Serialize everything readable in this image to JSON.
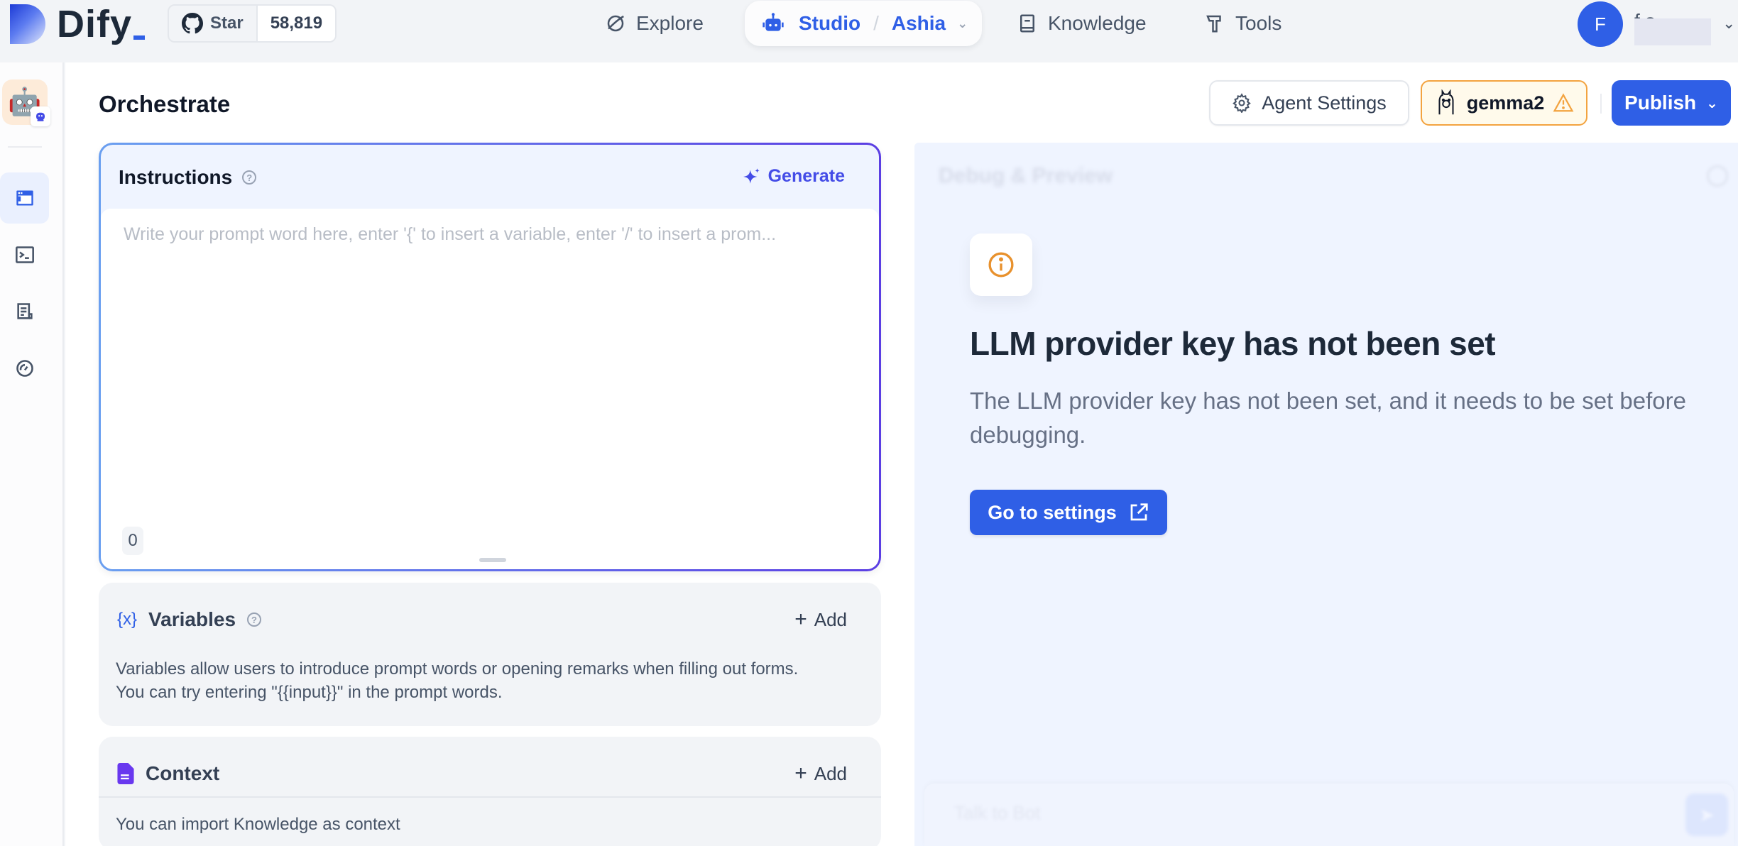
{
  "header": {
    "logo_text": "Dify",
    "github": {
      "star_label": "Star",
      "star_count": "58,819"
    },
    "nav": {
      "explore": "Explore",
      "studio": "Studio",
      "app_name": "Ashia",
      "knowledge": "Knowledge",
      "tools": "Tools"
    },
    "user": {
      "initial": "F",
      "name_partial": "f      s"
    }
  },
  "sidebar": {
    "app_icon": "🤖",
    "items": [
      {
        "name": "orchestrate",
        "icon": "window-icon",
        "active": true
      },
      {
        "name": "api-access",
        "icon": "terminal-icon",
        "active": false
      },
      {
        "name": "logs",
        "icon": "document-icon",
        "active": false
      },
      {
        "name": "monitoring",
        "icon": "gauge-icon",
        "active": false
      }
    ]
  },
  "main": {
    "title": "Orchestrate",
    "agent_settings_label": "Agent Settings",
    "model_name": "gemma2",
    "publish_label": "Publish",
    "instructions": {
      "title": "Instructions",
      "generate_label": "Generate",
      "placeholder": "Write your prompt word here, enter '{' to insert a variable, enter '/' to insert a prom...",
      "char_count": "0"
    },
    "variables": {
      "title": "Variables",
      "add_label": "Add",
      "description_line1": "Variables allow users to introduce prompt words or opening remarks when filling out forms.",
      "description_line2": "You can try entering \"{{input}}\" in the prompt words."
    },
    "context": {
      "title": "Context",
      "add_label": "Add",
      "description": "You can import Knowledge as context"
    }
  },
  "debug": {
    "title": "Debug & Preview",
    "warning_title": "LLM provider key has not been set",
    "warning_description": "The LLM provider key has not been set, and it needs to be set before debugging.",
    "goto_settings_label": "Go to settings",
    "chat_placeholder": "Talk to Bot"
  },
  "colors": {
    "accent": "#2f5fe6",
    "generate": "#444ce7",
    "warning": "#f3a33f",
    "debug_bg": "#eff4ff"
  }
}
